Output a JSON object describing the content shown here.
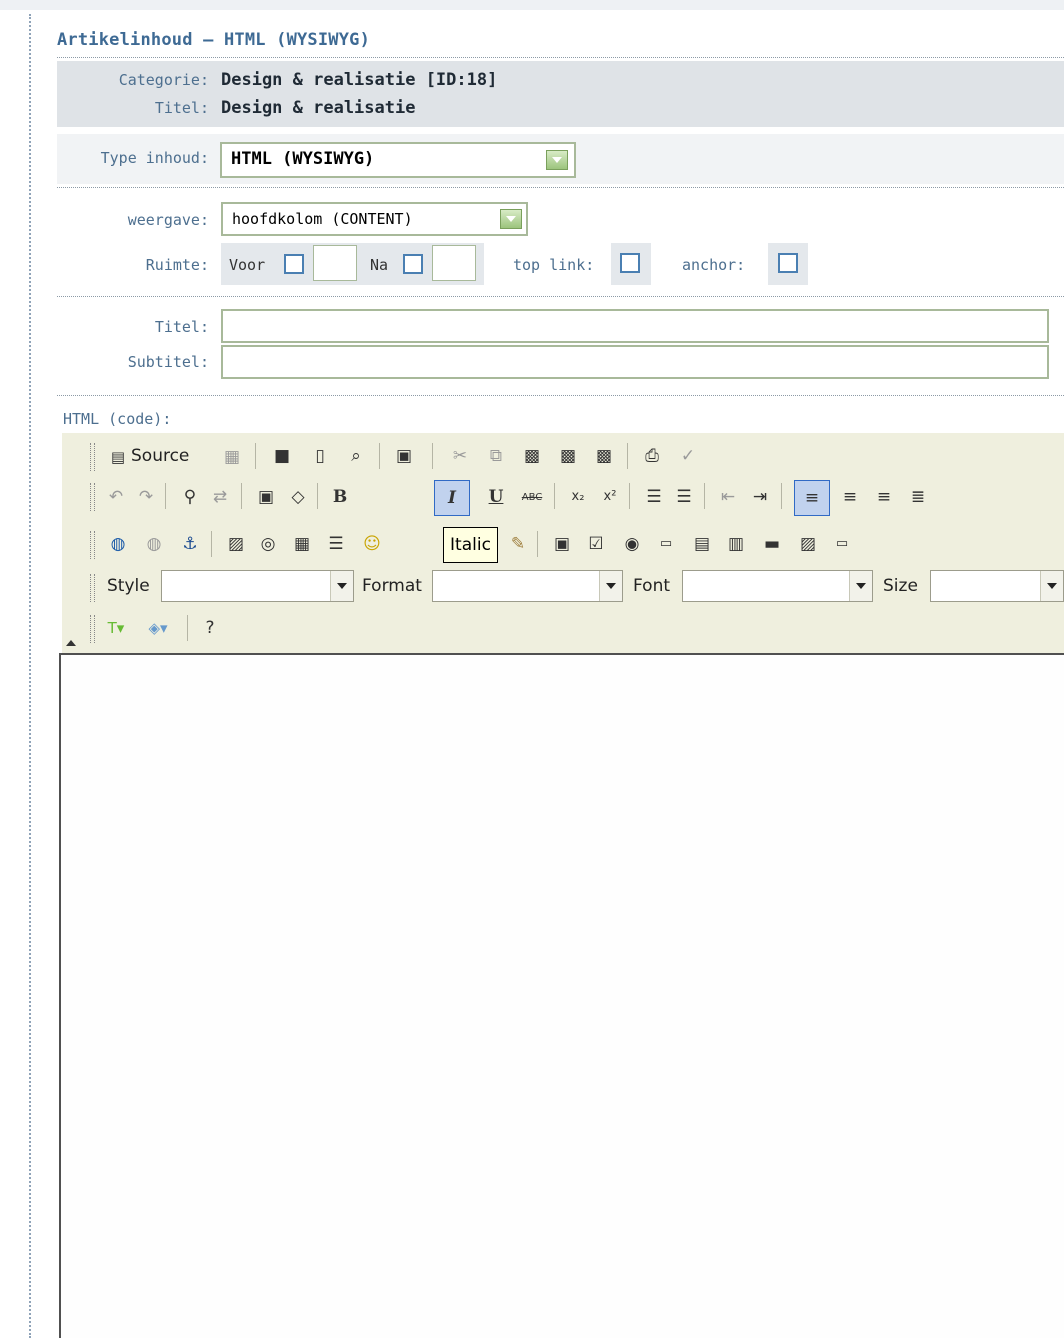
{
  "header": {
    "title": "Artikelinhoud — HTML (WYSIWYG)"
  },
  "info": {
    "category_label": "Categorie:",
    "category_value": "Design & realisatie [ID:18]",
    "title_label": "Titel:",
    "title_value": "Design & realisatie"
  },
  "type": {
    "label": "Type inhoud:",
    "value": "HTML (WYSIWYG)"
  },
  "display": {
    "label": "weergave:",
    "value": "hoofdkolom (CONTENT)"
  },
  "space": {
    "label": "Ruimte:",
    "before_label": "Voor",
    "after_label": "Na",
    "toplink_label": "top link:",
    "anchor_label": "anchor:"
  },
  "fields": {
    "title_label": "Titel:",
    "subtitle_label": "Subtitel:"
  },
  "editor": {
    "label": "HTML (code):",
    "source_label": "Source",
    "style_label": "Style",
    "format_label": "Format",
    "font_label": "Font",
    "size_label": "Size",
    "tooltip": "Italic",
    "bold_glyph": "B",
    "italic_glyph": "I",
    "underline_glyph": "U",
    "strike_glyph": "ABC"
  }
}
